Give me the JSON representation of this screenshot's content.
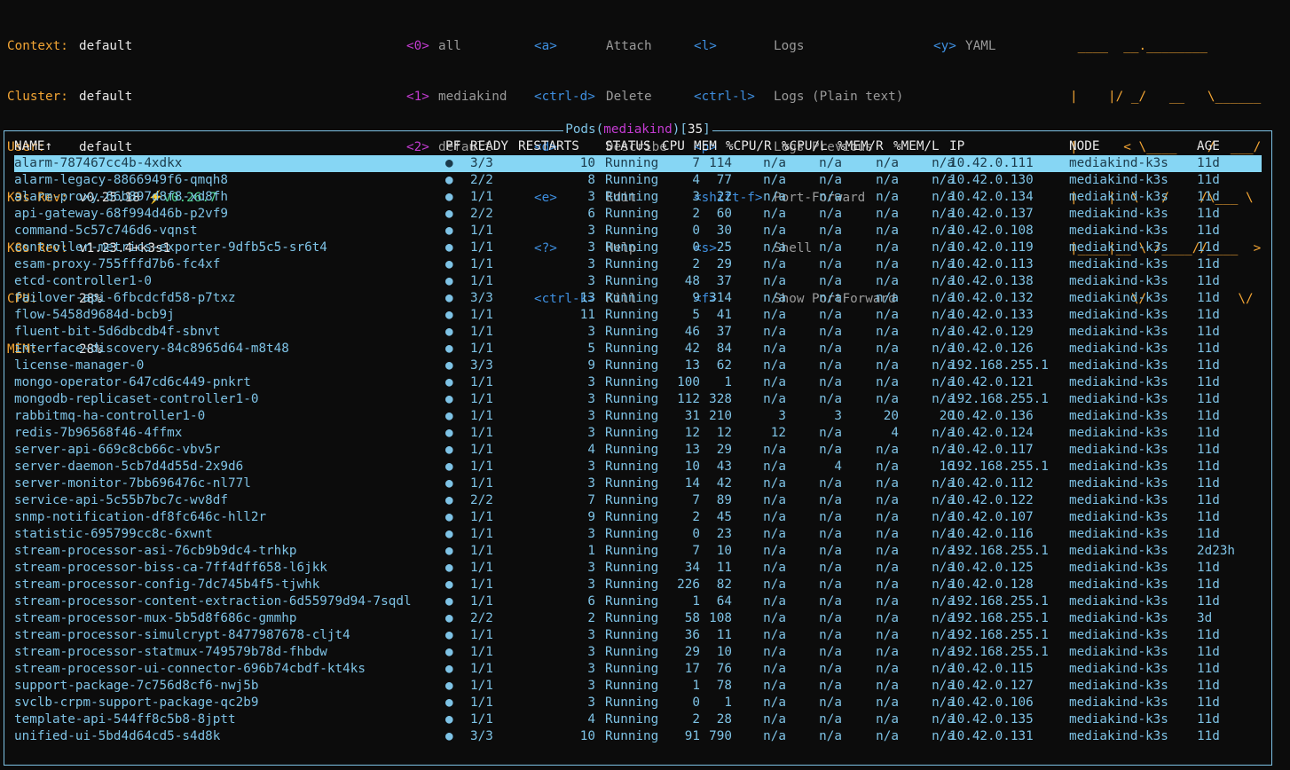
{
  "info": [
    {
      "label": "Context:",
      "value": "default"
    },
    {
      "label": "Cluster:",
      "value": "default"
    },
    {
      "label": "User:",
      "value": "default"
    },
    {
      "label": "K9s Rev:",
      "value": "v0.25.18",
      "extra": "⚡️v0.26.7"
    },
    {
      "label": "K8s Rev:",
      "value": "v1.23.4+k3s1"
    },
    {
      "label": "CPU:",
      "value": "28%"
    },
    {
      "label": "MEM:",
      "value": "28%"
    }
  ],
  "namespaces": [
    {
      "key": "<0>",
      "name": "all"
    },
    {
      "key": "<1>",
      "name": "mediakind"
    },
    {
      "key": "<2>",
      "name": "default"
    }
  ],
  "hints_col1": [
    {
      "key": "<a>",
      "label": "Attach"
    },
    {
      "key": "<ctrl-d>",
      "label": "Delete"
    },
    {
      "key": "<d>",
      "label": "Describe"
    },
    {
      "key": "<e>",
      "label": "Edit"
    },
    {
      "key": "<?>",
      "label": "Help"
    },
    {
      "key": "<ctrl-k>",
      "label": "Kill"
    }
  ],
  "hints_col2": [
    {
      "key": "<l>",
      "label": "Logs"
    },
    {
      "key": "<ctrl-l>",
      "label": "Logs (Plain text)"
    },
    {
      "key": "<p>",
      "label": "Logs Previous"
    },
    {
      "key": "<shift-f>",
      "label": "Port-Forward"
    },
    {
      "key": "<s>",
      "label": "Shell"
    },
    {
      "key": "<f>",
      "label": "Show PortForward"
    }
  ],
  "hints_col3": [
    {
      "key": "<y>",
      "label": "YAML"
    }
  ],
  "logo": [
    " ____  __.________       ",
    "|    |/ _/   __   \\______",
    "|      < \\____    /  ___/",
    "|    |  \\   /    /\\___ \\ ",
    "|____|__ \\ /____//____  >",
    "        \\/            \\/ "
  ],
  "view": {
    "resource": "Pods",
    "namespace": "mediakind",
    "count": "35"
  },
  "columns": {
    "name": "NAME↑",
    "pf": "PF",
    "ready": "READY",
    "restarts": "RESTARTS",
    "status": "STATUS",
    "cpu": "CPU",
    "mem": "MEM",
    "cpur": "%CPU/R",
    "cpul": "%CPU/L",
    "memr": "%MEM/R",
    "meml": "%MEM/L",
    "ip": "IP",
    "node": "NODE",
    "age": "AGE"
  },
  "pods": [
    [
      "alarm-787467cc4b-4xdkx",
      "●",
      "3/3",
      "10",
      "Running",
      "7",
      "114",
      "n/a",
      "n/a",
      "n/a",
      "n/a",
      "10.42.0.111",
      "mediakind-k3s",
      "11d"
    ],
    [
      "alarm-legacy-8866949f6-qmqh8",
      "●",
      "2/2",
      "8",
      "Running",
      "4",
      "77",
      "n/a",
      "n/a",
      "n/a",
      "n/a",
      "10.42.0.130",
      "mediakind-k3s",
      "11d"
    ],
    [
      "alarm-proxy-66b897d8f8-xd8fh",
      "●",
      "1/1",
      "3",
      "Running",
      "3",
      "22",
      "n/a",
      "n/a",
      "n/a",
      "n/a",
      "10.42.0.134",
      "mediakind-k3s",
      "11d"
    ],
    [
      "api-gateway-68f994d46b-p2vf9",
      "●",
      "2/2",
      "6",
      "Running",
      "2",
      "60",
      "n/a",
      "n/a",
      "n/a",
      "n/a",
      "10.42.0.137",
      "mediakind-k3s",
      "11d"
    ],
    [
      "command-5c57c746d6-vqnst",
      "●",
      "1/1",
      "3",
      "Running",
      "0",
      "30",
      "n/a",
      "n/a",
      "n/a",
      "n/a",
      "10.42.0.108",
      "mediakind-k3s",
      "11d"
    ],
    [
      "controller-metrics-exporter-9dfb5c5-sr6t4",
      "●",
      "1/1",
      "3",
      "Running",
      "0",
      "25",
      "n/a",
      "n/a",
      "n/a",
      "n/a",
      "10.42.0.119",
      "mediakind-k3s",
      "11d"
    ],
    [
      "esam-proxy-755fffd7b6-fc4xf",
      "●",
      "1/1",
      "3",
      "Running",
      "2",
      "29",
      "n/a",
      "n/a",
      "n/a",
      "n/a",
      "10.42.0.113",
      "mediakind-k3s",
      "11d"
    ],
    [
      "etcd-controller1-0",
      "●",
      "1/1",
      "3",
      "Running",
      "48",
      "37",
      "n/a",
      "n/a",
      "n/a",
      "n/a",
      "10.42.0.138",
      "mediakind-k3s",
      "11d"
    ],
    [
      "failover-api-6fbcdcfd58-p7txz",
      "●",
      "3/3",
      "13",
      "Running",
      "9",
      "314",
      "n/a",
      "n/a",
      "n/a",
      "n/a",
      "10.42.0.132",
      "mediakind-k3s",
      "11d"
    ],
    [
      "flow-5458d9684d-bcb9j",
      "●",
      "1/1",
      "11",
      "Running",
      "5",
      "41",
      "n/a",
      "n/a",
      "n/a",
      "n/a",
      "10.42.0.133",
      "mediakind-k3s",
      "11d"
    ],
    [
      "fluent-bit-5d6dbcdb4f-sbnvt",
      "●",
      "1/1",
      "3",
      "Running",
      "46",
      "37",
      "n/a",
      "n/a",
      "n/a",
      "n/a",
      "10.42.0.129",
      "mediakind-k3s",
      "11d"
    ],
    [
      "interface-discovery-84c8965d64-m8t48",
      "●",
      "1/1",
      "5",
      "Running",
      "42",
      "84",
      "n/a",
      "n/a",
      "n/a",
      "n/a",
      "10.42.0.126",
      "mediakind-k3s",
      "11d"
    ],
    [
      "license-manager-0",
      "●",
      "3/3",
      "9",
      "Running",
      "13",
      "62",
      "n/a",
      "n/a",
      "n/a",
      "n/a",
      "192.168.255.1",
      "mediakind-k3s",
      "11d"
    ],
    [
      "mongo-operator-647cd6c449-pnkrt",
      "●",
      "1/1",
      "3",
      "Running",
      "100",
      "1",
      "n/a",
      "n/a",
      "n/a",
      "n/a",
      "10.42.0.121",
      "mediakind-k3s",
      "11d"
    ],
    [
      "mongodb-replicaset-controller1-0",
      "●",
      "1/1",
      "3",
      "Running",
      "112",
      "328",
      "n/a",
      "n/a",
      "n/a",
      "n/a",
      "192.168.255.1",
      "mediakind-k3s",
      "11d"
    ],
    [
      "rabbitmq-ha-controller1-0",
      "●",
      "1/1",
      "3",
      "Running",
      "31",
      "210",
      "3",
      "3",
      "20",
      "20",
      "10.42.0.136",
      "mediakind-k3s",
      "11d"
    ],
    [
      "redis-7b96568f46-4ffmx",
      "●",
      "1/1",
      "3",
      "Running",
      "12",
      "12",
      "12",
      "n/a",
      "4",
      "n/a",
      "10.42.0.124",
      "mediakind-k3s",
      "11d"
    ],
    [
      "server-api-669c8cb66c-vbv5r",
      "●",
      "1/1",
      "4",
      "Running",
      "13",
      "29",
      "n/a",
      "n/a",
      "n/a",
      "n/a",
      "10.42.0.117",
      "mediakind-k3s",
      "11d"
    ],
    [
      "server-daemon-5cb7d4d55d-2x9d6",
      "●",
      "1/1",
      "3",
      "Running",
      "10",
      "43",
      "n/a",
      "4",
      "n/a",
      "16",
      "192.168.255.1",
      "mediakind-k3s",
      "11d"
    ],
    [
      "server-monitor-7bb696476c-nl77l",
      "●",
      "1/1",
      "3",
      "Running",
      "14",
      "42",
      "n/a",
      "n/a",
      "n/a",
      "n/a",
      "10.42.0.112",
      "mediakind-k3s",
      "11d"
    ],
    [
      "service-api-5c55b7bc7c-wv8df",
      "●",
      "2/2",
      "7",
      "Running",
      "7",
      "89",
      "n/a",
      "n/a",
      "n/a",
      "n/a",
      "10.42.0.122",
      "mediakind-k3s",
      "11d"
    ],
    [
      "snmp-notification-df8fc646c-hll2r",
      "●",
      "1/1",
      "9",
      "Running",
      "2",
      "45",
      "n/a",
      "n/a",
      "n/a",
      "n/a",
      "10.42.0.107",
      "mediakind-k3s",
      "11d"
    ],
    [
      "statistic-695799cc8c-6xwnt",
      "●",
      "1/1",
      "3",
      "Running",
      "0",
      "23",
      "n/a",
      "n/a",
      "n/a",
      "n/a",
      "10.42.0.116",
      "mediakind-k3s",
      "11d"
    ],
    [
      "stream-processor-asi-76cb9b9dc4-trhkp",
      "●",
      "1/1",
      "1",
      "Running",
      "7",
      "10",
      "n/a",
      "n/a",
      "n/a",
      "n/a",
      "192.168.255.1",
      "mediakind-k3s",
      "2d23h"
    ],
    [
      "stream-processor-biss-ca-7ff4dff658-l6jkk",
      "●",
      "1/1",
      "3",
      "Running",
      "34",
      "11",
      "n/a",
      "n/a",
      "n/a",
      "n/a",
      "10.42.0.125",
      "mediakind-k3s",
      "11d"
    ],
    [
      "stream-processor-config-7dc745b4f5-tjwhk",
      "●",
      "1/1",
      "3",
      "Running",
      "226",
      "82",
      "n/a",
      "n/a",
      "n/a",
      "n/a",
      "10.42.0.128",
      "mediakind-k3s",
      "11d"
    ],
    [
      "stream-processor-content-extraction-6d55979d94-7sqdl",
      "●",
      "1/1",
      "6",
      "Running",
      "1",
      "64",
      "n/a",
      "n/a",
      "n/a",
      "n/a",
      "192.168.255.1",
      "mediakind-k3s",
      "11d"
    ],
    [
      "stream-processor-mux-5b5d8f686c-gmmhp",
      "●",
      "2/2",
      "2",
      "Running",
      "58",
      "108",
      "n/a",
      "n/a",
      "n/a",
      "n/a",
      "192.168.255.1",
      "mediakind-k3s",
      "3d"
    ],
    [
      "stream-processor-simulcrypt-8477987678-cljt4",
      "●",
      "1/1",
      "3",
      "Running",
      "36",
      "11",
      "n/a",
      "n/a",
      "n/a",
      "n/a",
      "192.168.255.1",
      "mediakind-k3s",
      "11d"
    ],
    [
      "stream-processor-statmux-749579b78d-fhbdw",
      "●",
      "1/1",
      "3",
      "Running",
      "29",
      "10",
      "n/a",
      "n/a",
      "n/a",
      "n/a",
      "192.168.255.1",
      "mediakind-k3s",
      "11d"
    ],
    [
      "stream-processor-ui-connector-696b74cbdf-kt4ks",
      "●",
      "1/1",
      "3",
      "Running",
      "17",
      "76",
      "n/a",
      "n/a",
      "n/a",
      "n/a",
      "10.42.0.115",
      "mediakind-k3s",
      "11d"
    ],
    [
      "support-package-7c756d8cf6-nwj5b",
      "●",
      "1/1",
      "3",
      "Running",
      "1",
      "78",
      "n/a",
      "n/a",
      "n/a",
      "n/a",
      "10.42.0.127",
      "mediakind-k3s",
      "11d"
    ],
    [
      "svclb-crpm-support-package-qc2b9",
      "●",
      "1/1",
      "3",
      "Running",
      "0",
      "1",
      "n/a",
      "n/a",
      "n/a",
      "n/a",
      "10.42.0.106",
      "mediakind-k3s",
      "11d"
    ],
    [
      "template-api-544ff8c5b8-8jptt",
      "●",
      "1/1",
      "4",
      "Running",
      "2",
      "28",
      "n/a",
      "n/a",
      "n/a",
      "n/a",
      "10.42.0.135",
      "mediakind-k3s",
      "11d"
    ],
    [
      "unified-ui-5bd4d64cd5-s4d8k",
      "●",
      "3/3",
      "10",
      "Running",
      "91",
      "790",
      "n/a",
      "n/a",
      "n/a",
      "n/a",
      "10.42.0.131",
      "mediakind-k3s",
      "11d"
    ]
  ]
}
